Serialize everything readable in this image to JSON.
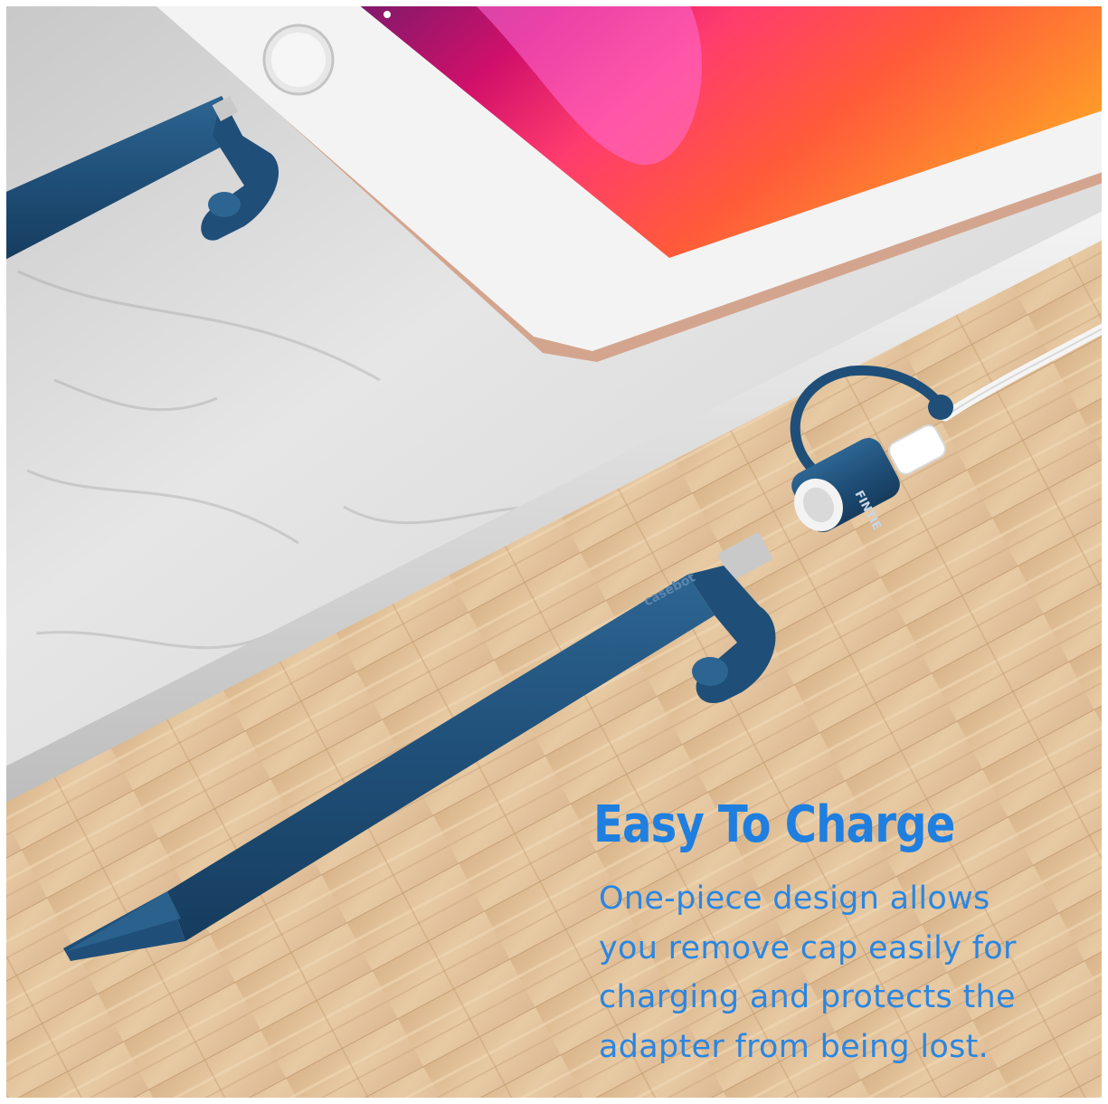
{
  "headline": "Easy To Charge",
  "body_lines": [
    "One-piece design allows",
    "you remove cap easily for",
    "charging and protects the",
    "adapter from being lost."
  ],
  "pencil_brand": "casebot",
  "adapter_brand": "FINTIE",
  "colors": {
    "accent_text": "#1f7fe0",
    "silicone_navy": "#1f4f78",
    "wood": "#e4c49c",
    "marble": "#dadada"
  }
}
